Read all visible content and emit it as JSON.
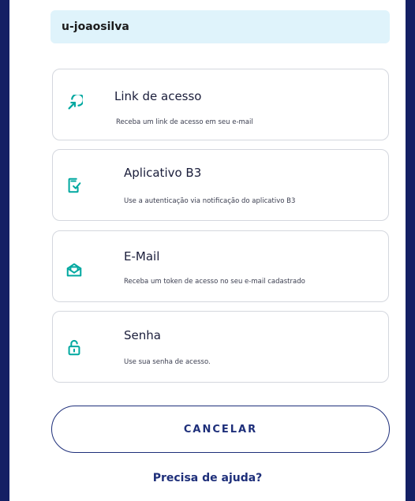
{
  "username": "u-joaosilva",
  "options": [
    {
      "title": "Link de acesso",
      "description": "Receba um link de acesso em seu e-mail",
      "icon": "link-access-icon"
    },
    {
      "title": "Aplicativo B3",
      "description": "Use a autenticação via notificação do aplicativo B3",
      "icon": "mobile-check-icon"
    },
    {
      "title": "E-Mail",
      "description": "Receba um token de acesso no seu e-mail cadastrado",
      "icon": "email-open-icon"
    },
    {
      "title": "Senha",
      "description": "Use sua senha de acesso.",
      "icon": "lock-icon"
    }
  ],
  "cancel_label": "CANCELAR",
  "help_link": "Precisa de ajuda?",
  "colors": {
    "background": "#142064",
    "accent": "#00a8a0",
    "primary": "#1e2f7a",
    "username_bg": "#dff3fb"
  }
}
